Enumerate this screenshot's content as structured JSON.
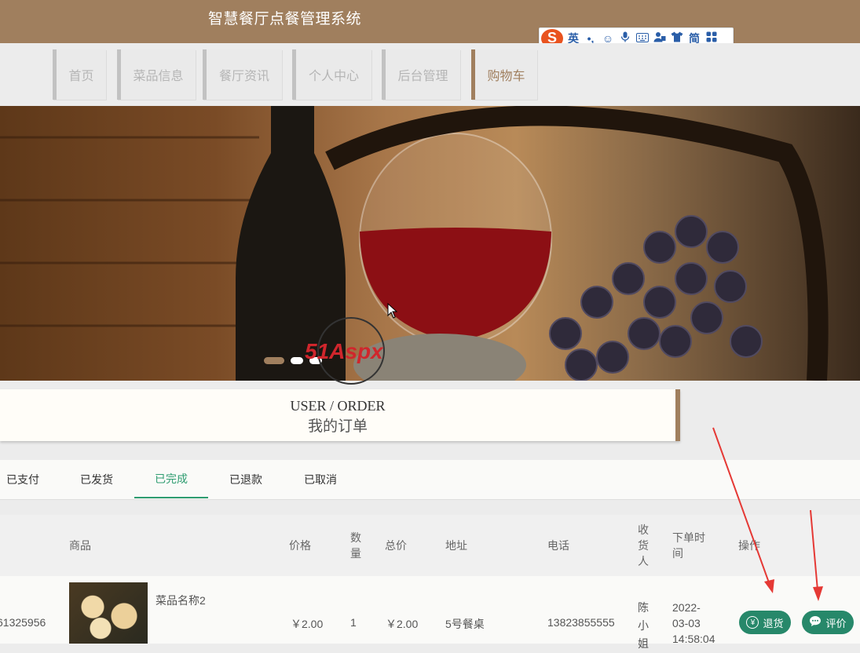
{
  "header": {
    "title": "智慧餐厅点餐管理系统"
  },
  "ime_toolbar": {
    "logo": "S",
    "items": [
      "英",
      "•,",
      "☺",
      "mic-icon",
      "keyboard-icon",
      "user-icon",
      "shirt-icon",
      "简",
      "grid-icon"
    ]
  },
  "nav": {
    "items": [
      {
        "label": "首页",
        "active": false
      },
      {
        "label": "菜品信息",
        "active": false
      },
      {
        "label": "餐厅资讯",
        "active": false
      },
      {
        "label": "个人中心",
        "active": false
      },
      {
        "label": "后台管理",
        "active": false
      },
      {
        "label": "购物车",
        "active": true
      }
    ]
  },
  "banner": {
    "watermark": "51Aspx"
  },
  "order_section": {
    "title_en": "USER / ORDER",
    "title_zh": "我的订单"
  },
  "tabs": [
    {
      "label": "已支付",
      "active": false
    },
    {
      "label": "已发货",
      "active": false
    },
    {
      "label": "已完成",
      "active": true
    },
    {
      "label": "已退款",
      "active": false
    },
    {
      "label": "已取消",
      "active": false
    }
  ],
  "table": {
    "headers": {
      "product": "商品",
      "price": "价格",
      "qty": "数\n量",
      "total": "总价",
      "address": "地址",
      "phone": "电话",
      "receiver": "收\n货\n人",
      "order_time": "下单时\n间",
      "action": "操作"
    },
    "rows": [
      {
        "order_no": "61325956",
        "product_name": "菜品名称2",
        "price": "￥2.00",
        "qty": "1",
        "total": "￥2.00",
        "address": "5号餐桌",
        "phone": "13823855555",
        "receiver": "陈\n小\n姐",
        "order_time": "2022-\n03-03\n14:58:04",
        "actions": {
          "refund": "退货",
          "review": "评价"
        }
      }
    ]
  },
  "colors": {
    "brand": "#a07f5e",
    "accent": "#27886a",
    "active_tab": "#2e9c70",
    "arrow": "#e53935"
  }
}
